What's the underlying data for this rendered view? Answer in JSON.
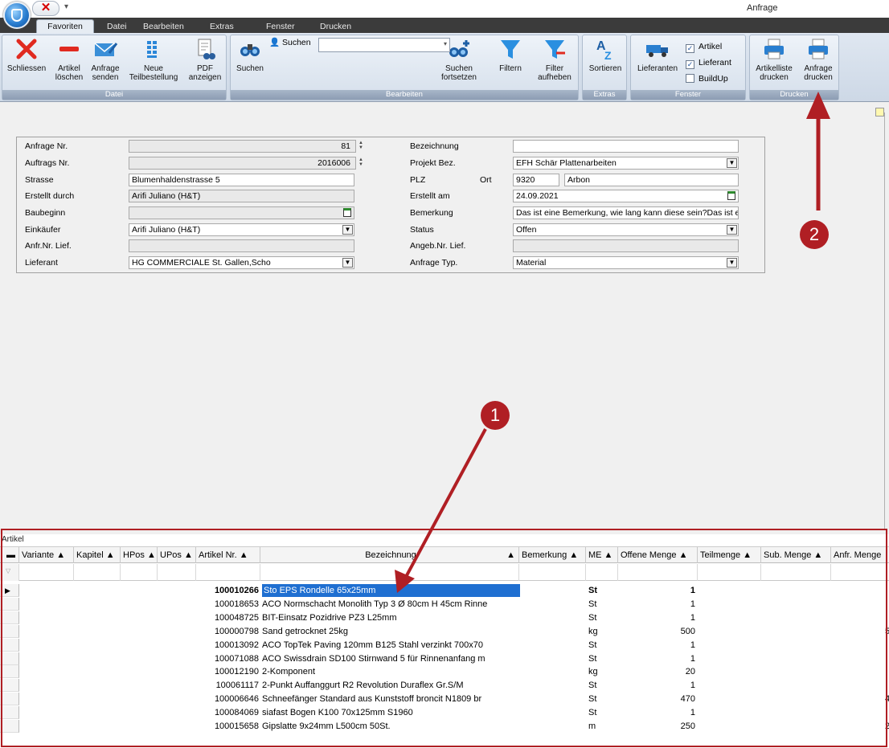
{
  "window": {
    "title": "Anfrage"
  },
  "quick_access": {
    "close_glyph": "✕",
    "more_glyph": "▾"
  },
  "tabs": [
    {
      "label": "Favoriten",
      "active": true
    },
    {
      "label": "Datei"
    },
    {
      "label": "Bearbeiten"
    },
    {
      "label": "Extras"
    },
    {
      "label": "Fenster"
    },
    {
      "label": "Drucken"
    }
  ],
  "ribbon": {
    "groups": {
      "datei": "Datei",
      "bearbeiten": "Bearbeiten",
      "extras": "Extras",
      "fenster": "Fenster",
      "drucken": "Drucken"
    },
    "buttons": {
      "schliessen": "Schliessen",
      "artikel_loeschen": "Artikel\nlöschen",
      "anfrage_senden": "Anfrage\nsenden",
      "neue_teilbestellung": "Neue\nTeilbestellung",
      "pdf_anzeigen": "PDF\nanzeigen",
      "suchen": "Suchen",
      "suchen_fortsetzen": "Suchen\nfortsetzen",
      "filtern": "Filtern",
      "filter_aufheben": "Filter\naufheben",
      "sortieren": "Sortieren",
      "lieferanten": "Lieferanten",
      "artikelliste_drucken": "Artikelliste\ndrucken",
      "anfrage_drucken": "Anfrage\ndrucken"
    },
    "search": {
      "label": "Suchen",
      "value": ""
    },
    "checkboxes": [
      {
        "label": "Artikel",
        "checked": true
      },
      {
        "label": "Lieferant",
        "checked": true
      },
      {
        "label": "BuildUp",
        "checked": false
      }
    ]
  },
  "form": {
    "left": [
      {
        "label": "Anfrage Nr.",
        "value": "81"
      },
      {
        "label": "Auftrags Nr.",
        "value": "2016006"
      },
      {
        "label": "Strasse",
        "value": "Blumenhaldenstrasse 5"
      },
      {
        "label": "Erstellt durch",
        "value": "Arifi Juliano (H&T)"
      },
      {
        "label": "Baubeginn",
        "value": ""
      },
      {
        "label": "Einkäufer",
        "value": "Arifi Juliano (H&T)"
      },
      {
        "label": "Anfr.Nr. Lief.",
        "value": ""
      },
      {
        "label": "Lieferant",
        "value": "HG COMMERCIALE St. Gallen,Scho"
      }
    ],
    "right": [
      {
        "label": "Bezeichnung",
        "value": ""
      },
      {
        "label": "Projekt Bez.",
        "value": "EFH Schär Plattenarbeiten"
      },
      {
        "label": "PLZ",
        "value": "9320"
      },
      {
        "label": "Erstellt am",
        "value": "24.09.2021"
      },
      {
        "label": "Bemerkung",
        "value": "Das ist eine Bemerkung, wie lang kann diese sein?Das ist e"
      },
      {
        "label": "Status",
        "value": "Offen"
      },
      {
        "label": "Angeb.Nr. Lief.",
        "value": ""
      },
      {
        "label": "Anfrage Typ.",
        "value": "Material"
      }
    ],
    "ort": {
      "label": "Ort",
      "value": "Arbon"
    }
  },
  "grid": {
    "title": "Artikel",
    "columns": [
      "Variante",
      "Kapitel",
      "HPos",
      "UPos",
      "Artikel Nr.",
      "Bezeichnung",
      "Bemerkung",
      "ME",
      "Offene Menge",
      "Teilmenge",
      "Sub. Menge",
      "Anfr. Menge"
    ],
    "rows": [
      {
        "artikel_nr": "100010266",
        "bezeichnung": "Sto EPS Rondelle 65x25mm",
        "me": "St",
        "offene_menge": "1",
        "edge": ""
      },
      {
        "artikel_nr": "100018653",
        "bezeichnung": "ACO Normschacht Monolith Typ 3 Ø 80cm H 45cm Rinne",
        "me": "St",
        "offene_menge": "1",
        "edge": ""
      },
      {
        "artikel_nr": "100048725",
        "bezeichnung": "BIT-Einsatz Pozidrive PZ3 L25mm",
        "me": "St",
        "offene_menge": "1",
        "edge": ""
      },
      {
        "artikel_nr": "100000798",
        "bezeichnung": "Sand getrocknet 25kg",
        "me": "kg",
        "offene_menge": "500",
        "edge": "5"
      },
      {
        "artikel_nr": "100013092",
        "bezeichnung": "ACO TopTek Paving 120mm B125 Stahl verzinkt 700x70",
        "me": "St",
        "offene_menge": "1",
        "edge": ""
      },
      {
        "artikel_nr": "100071088",
        "bezeichnung": "ACO Swissdrain SD100 Stirnwand 5 für Rinnenanfang m",
        "me": "St",
        "offene_menge": "1",
        "edge": ""
      },
      {
        "artikel_nr": "100012190",
        "bezeichnung": "2-Komponent",
        "me": "kg",
        "offene_menge": "20",
        "edge": ""
      },
      {
        "artikel_nr": "100061117",
        "bezeichnung": "2-Punkt Auffanggurt R2 Revolution Duraflex Gr.S/M",
        "me": "St",
        "offene_menge": "1",
        "edge": ""
      },
      {
        "artikel_nr": "100006646",
        "bezeichnung": "Schneefänger Standard aus Kunststoff broncit N1809 br",
        "me": "St",
        "offene_menge": "470",
        "edge": "4"
      },
      {
        "artikel_nr": "100084069",
        "bezeichnung": "siafast Bogen K100 70x125mm S1960",
        "me": "St",
        "offene_menge": "1",
        "edge": ""
      },
      {
        "artikel_nr": "100015658",
        "bezeichnung": "Gipslatte 9x24mm L500cm 50St.",
        "me": "m",
        "offene_menge": "250",
        "edge": "2"
      }
    ]
  },
  "annotations": {
    "badge1": "1",
    "badge2": "2"
  },
  "colors": {
    "annotation": "#b01f24",
    "selection": "#1f6fd1"
  }
}
